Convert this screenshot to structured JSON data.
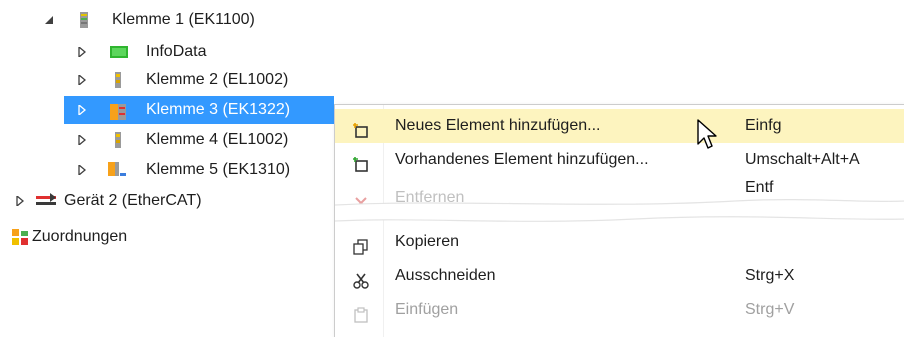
{
  "tree": {
    "items": [
      {
        "label": "Klemme 1 (EK1100)",
        "icon": "coupler-terminal-icon"
      },
      {
        "label": "InfoData",
        "icon": "infodata-icon"
      },
      {
        "label": "Klemme 2 (EL1002)",
        "icon": "terminal-icon"
      },
      {
        "label": "Klemme 3 (EK1322)",
        "icon": "terminal-junction-icon"
      },
      {
        "label": "Klemme 4 (EL1002)",
        "icon": "terminal-icon"
      },
      {
        "label": "Klemme 5 (EK1310)",
        "icon": "terminal-extension-icon"
      },
      {
        "label": "Gerät 2 (EtherCAT)",
        "icon": "ethercat-device-icon"
      },
      {
        "label": "Zuordnungen",
        "icon": "mappings-icon"
      }
    ]
  },
  "context_menu": {
    "items": [
      {
        "label": "Neues Element hinzufügen...",
        "shortcut": "Einfg",
        "icon": "new-item-icon"
      },
      {
        "label": "Vorhandenes Element hinzufügen...",
        "shortcut": "Umschalt+Alt+A",
        "icon": "existing-item-icon"
      },
      {
        "label": "Entfernen",
        "shortcut": "Entf",
        "icon": "remove-icon"
      },
      {
        "label": "Kopieren",
        "shortcut": "",
        "icon": "copy-icon"
      },
      {
        "label": "Ausschneiden",
        "shortcut": "Strg+X",
        "icon": "cut-icon"
      },
      {
        "label": "Einfügen",
        "shortcut": "Strg+V",
        "icon": "paste-icon"
      }
    ]
  },
  "colors": {
    "selection": "#3399ff",
    "menu_highlight": "#fdf4bf",
    "disabled_text": "#a0a0a0"
  }
}
